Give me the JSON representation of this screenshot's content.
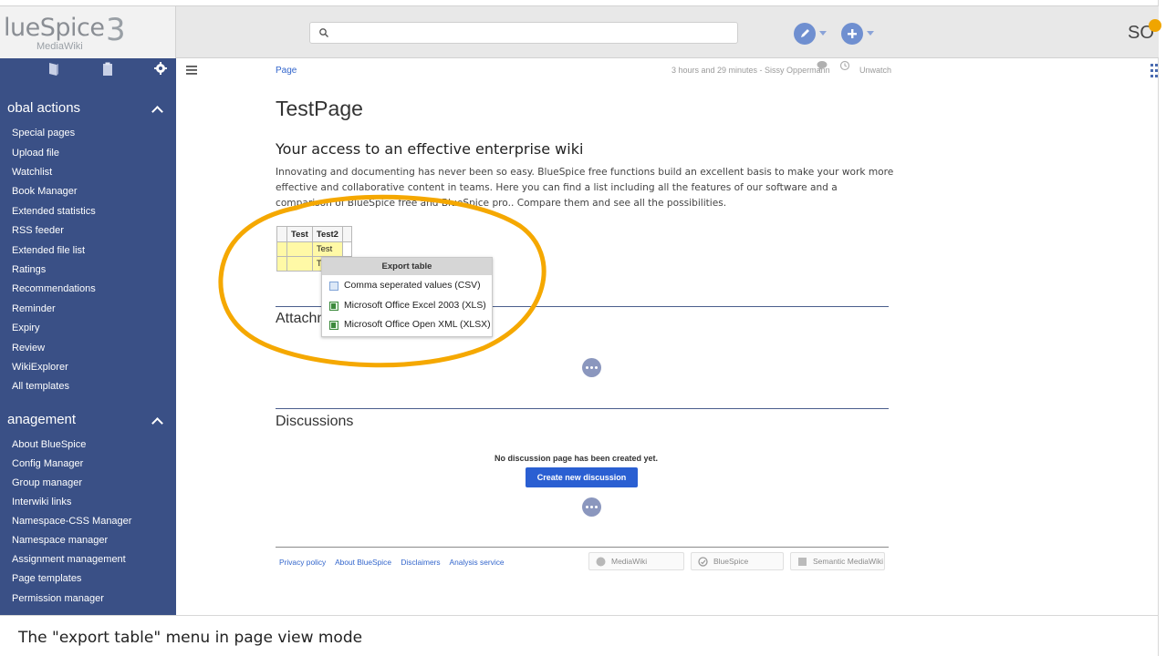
{
  "app": {
    "logo_text": "lueSpice",
    "logo_version": "3",
    "logo_sub": "MediaWiki"
  },
  "topbar": {
    "search_placeholder": "",
    "user_initials": "SO"
  },
  "sidebar": {
    "global_actions": {
      "title": "obal actions",
      "items": [
        "Special pages",
        "Upload file",
        "Watchlist",
        "Book Manager",
        "Extended statistics",
        "RSS feeder",
        "Extended file list",
        "Ratings",
        "Recommendations",
        "Reminder",
        "Expiry",
        "Review",
        "WikiExplorer",
        "All templates"
      ]
    },
    "management": {
      "title": "anagement",
      "items": [
        "About BlueSpice",
        "Config Manager",
        "Group manager",
        "Interwiki links",
        "Namespace-CSS Manager",
        "Namespace manager",
        "Assignment management",
        "Page templates",
        "Permission manager"
      ]
    }
  },
  "page": {
    "breadcrumb": "Page",
    "meta": "3 hours and 29 minutes - Sissy Oppermann",
    "unwatch": "Unwatch",
    "title": "TestPage",
    "heading": "Your access to an effective enterprise wiki",
    "paragraph": "Innovating and documenting has never been so easy. BlueSpice free functions build an excellent basis to make your work more effective and collaborative content in teams. Here you can find a list including all the features of our software and a comparison of BlueSpice free and BlueSpice pro.. Compare them and see all the possibilities.",
    "table": {
      "headers": [
        "",
        "Test",
        "Test2",
        ""
      ],
      "rows": [
        [
          "",
          "",
          "Test",
          ""
        ],
        [
          "",
          "",
          "Te",
          ""
        ]
      ]
    },
    "attachments_title": "Attachments",
    "discussions_title": "Discussions",
    "no_discussion": "No discussion page has been created yet.",
    "create_discussion": "Create new discussion"
  },
  "export_menu": {
    "title": "Export table",
    "items": [
      {
        "label": "Comma seperated values (CSV)",
        "icon": "csv-icon"
      },
      {
        "label": "Microsoft Office Excel 2003 (XLS)",
        "icon": "excel-icon"
      },
      {
        "label": "Microsoft Office Open XML (XLSX)",
        "icon": "excel-icon"
      }
    ]
  },
  "footer": {
    "links": [
      "Privacy policy",
      "About BlueSpice",
      "Disclaimers",
      "Analysis service"
    ],
    "badges": [
      "MediaWiki",
      "BlueSpice",
      "Semantic MediaWiki"
    ]
  },
  "caption": "The \"export table\" menu in page view mode",
  "colors": {
    "sidebar": "#3a5086",
    "accent": "#2a5fd2",
    "highlight_ring": "#f5a800"
  }
}
